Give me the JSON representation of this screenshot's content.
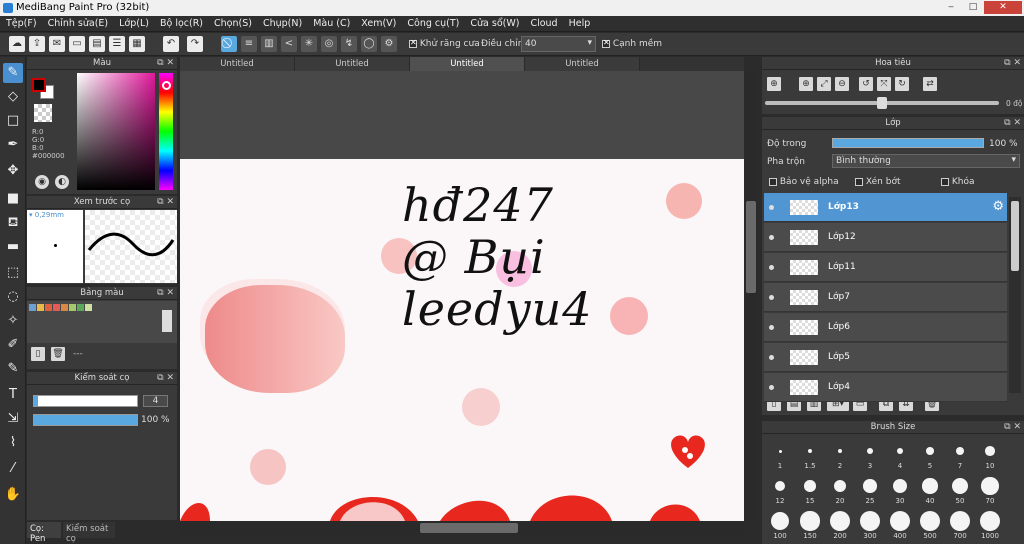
{
  "app": {
    "title": "MediBang Paint Pro (32bit)",
    "win_min": "‒",
    "win_max": "□",
    "win_close": "✕"
  },
  "menu": [
    "Tệp(F)",
    "Chỉnh sửa(E)",
    "Lớp(L)",
    "Bộ lọc(R)",
    "Chọn(S)",
    "Chụp(N)",
    "Màu (C)",
    "Xem(V)",
    "Công cụ(T)",
    "Cửa sổ(W)",
    "Cloud",
    "Help"
  ],
  "toolbar": {
    "antialias_label": "Khử răng cưa",
    "adjust_label": "Điều chỉnh",
    "adjust_value": "40",
    "edge_label": "Cạnh mềm"
  },
  "tabs": [
    "Untitled",
    "Untitled",
    "Untitled",
    "Untitled"
  ],
  "color_panel": {
    "title": "Màu",
    "r": "R:0",
    "g": "G:0",
    "b": "B:0",
    "hex": "#000000"
  },
  "brush_preview": {
    "title": "Xem trước cọ",
    "size": "0,29mm"
  },
  "palette": {
    "title": "Bảng màu",
    "dash": "---",
    "colors": [
      "#6da0d0",
      "#e8b84a",
      "#e25f3c",
      "#e25a5a",
      "#d88844",
      "#a5c86a",
      "#5aa85a",
      "#d0e0a0"
    ]
  },
  "brush_control": {
    "title": "Kiểm soát cọ",
    "size_value": "4",
    "opacity_value": "100 %",
    "size_fraction": 0.04,
    "opacity_fraction": 1.0
  },
  "bottom_tabs": [
    "Cọ: Pen",
    "Kiểm soát cọ"
  ],
  "navigator": {
    "title": "Hoa tiêu",
    "rotation": "0 độ"
  },
  "layer_panel": {
    "title": "Lớp",
    "opacity_label": "Độ trong",
    "opacity_value": "100 %",
    "blend_label": "Pha trộn",
    "blend_value": "Bình thường",
    "protect_alpha": "Bảo vệ alpha",
    "clipping": "Xén bớt",
    "lock": "Khóa"
  },
  "layers": [
    {
      "name": "Lớp13",
      "selected": true
    },
    {
      "name": "Lớp12",
      "selected": false
    },
    {
      "name": "Lớp11",
      "selected": false
    },
    {
      "name": "Lớp7",
      "selected": false
    },
    {
      "name": "Lớp6",
      "selected": false
    },
    {
      "name": "Lớp5",
      "selected": false
    },
    {
      "name": "Lớp4",
      "selected": false
    }
  ],
  "brush_size": {
    "title": "Brush Size",
    "sizes": [
      "1",
      "1.5",
      "2",
      "3",
      "4",
      "5",
      "7",
      "10",
      "12",
      "15",
      "20",
      "25",
      "30",
      "40",
      "50",
      "70",
      "100",
      "150",
      "200",
      "300",
      "400",
      "500",
      "700",
      "1000"
    ]
  },
  "artwork": {
    "line1": "hđ247",
    "line2": "@ Bụi",
    "line3": "leedyu4"
  }
}
